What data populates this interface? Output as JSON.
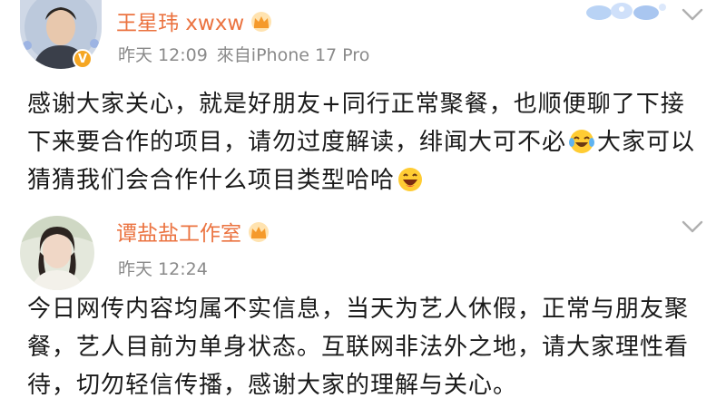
{
  "post1": {
    "author_name": "王星玮 xwxw",
    "time": "昨天 12:09",
    "source": "來自iPhone 17 Pro",
    "text_before_emoji": "感谢大家关心，就是好朋友+同行正常聚餐，也顺便聊了下接下来要合作的项目，请勿过度解读，绯闻大可不必",
    "text_after_emoji": "大家可以猜猜我们会合作什么项目类型哈哈",
    "emoji1": "laughing-tears-emoji",
    "emoji2": "grinning-emoji",
    "badge_icon": "crown-icon",
    "verified_icon": "v-verified-icon"
  },
  "post2": {
    "author_name": "谭盐盐工作室",
    "time": "昨天 12:24",
    "text": "今日网传内容均属不实信息，当天为艺人休假，正常与朋友聚餐，艺人目前为单身状态。互联网非法外之地，请大家理性看待，切勿轻信传播，感谢大家的理解与关心。",
    "badge_icon": "crown-icon"
  },
  "colors": {
    "name_color": "#eb7340",
    "meta_color": "#8a8a8a",
    "text_color": "#1a1a1a",
    "verified_badge": "#f5a623"
  }
}
